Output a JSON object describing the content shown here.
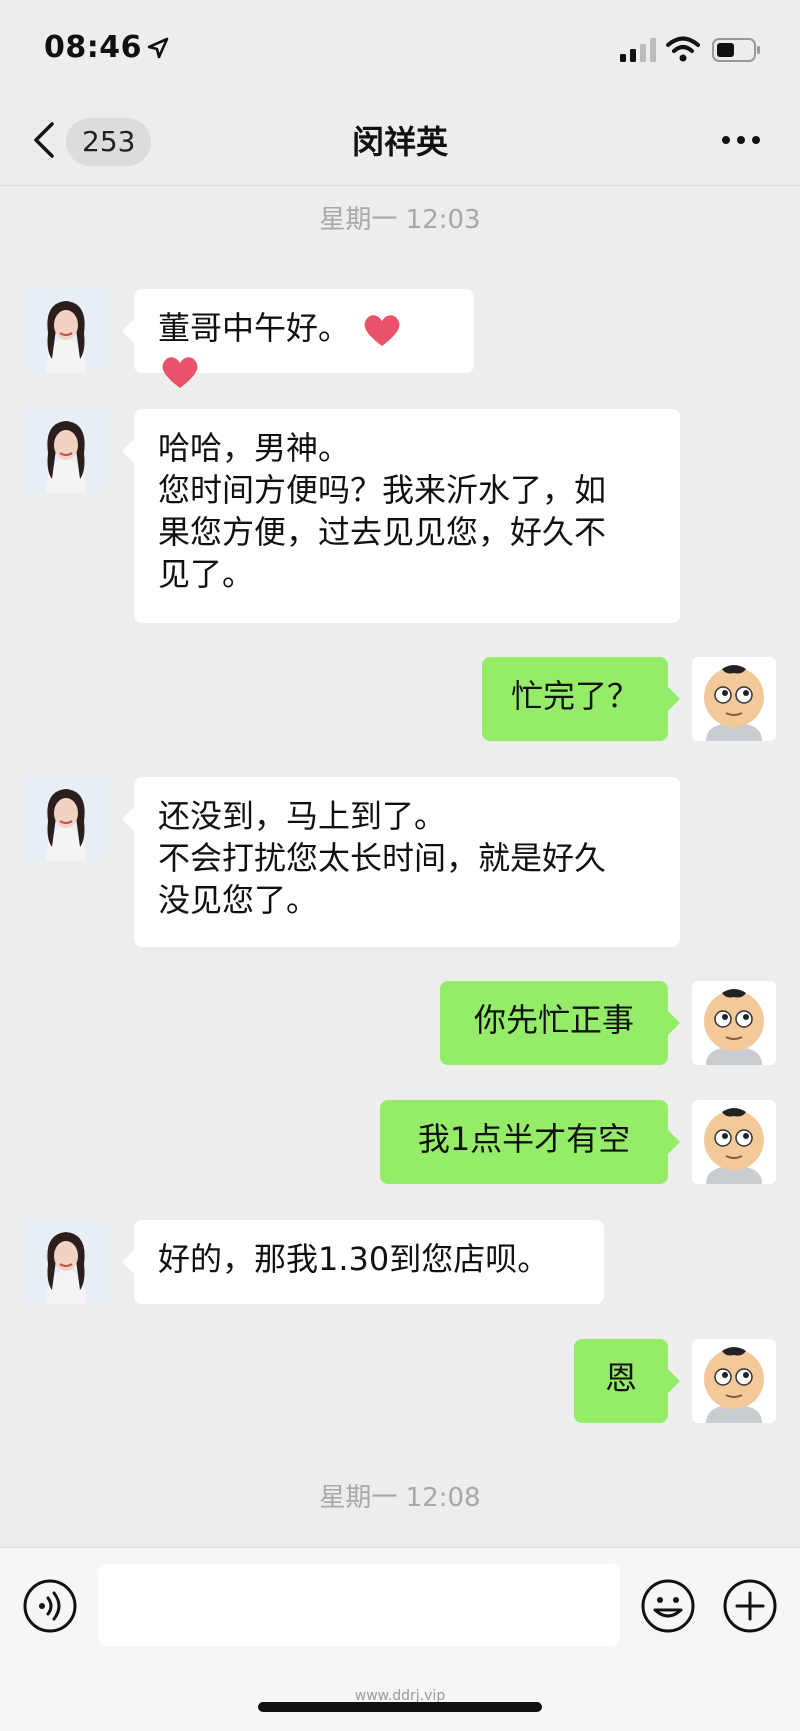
{
  "status_bar": {
    "time": "08:46"
  },
  "nav": {
    "unread_count": "253",
    "title": "闵祥英"
  },
  "chat": {
    "timestamp_1": "星期一 12:03",
    "timestamp_2": "星期一 12:08",
    "messages": [
      {
        "side": "in",
        "lines": [
          "董哥中午好。"
        ],
        "emoji": "❤❤"
      },
      {
        "side": "in",
        "lines": [
          "哈哈，男神。",
          "您时间方便吗？我来沂水了，如",
          "果您方便，过去见见您，好久不",
          "见了。"
        ]
      },
      {
        "side": "out",
        "lines": [
          "忙完了？"
        ]
      },
      {
        "side": "in",
        "lines": [
          "还没到，马上到了。",
          "不会打扰您太长时间，就是好久",
          "没见您了。"
        ]
      },
      {
        "side": "out",
        "lines": [
          "你先忙正事"
        ]
      },
      {
        "side": "out",
        "lines": [
          "我1点半才有空"
        ]
      },
      {
        "side": "in",
        "lines": [
          "好的，那我1.30到您店呗。"
        ]
      },
      {
        "side": "out",
        "lines": [
          "恩"
        ]
      }
    ]
  },
  "input": {
    "placeholder": ""
  },
  "watermark": "www.ddrj.vip",
  "colors": {
    "background": "#ededed",
    "outgoing_bubble": "#95ec69",
    "incoming_bubble": "#ffffff"
  }
}
